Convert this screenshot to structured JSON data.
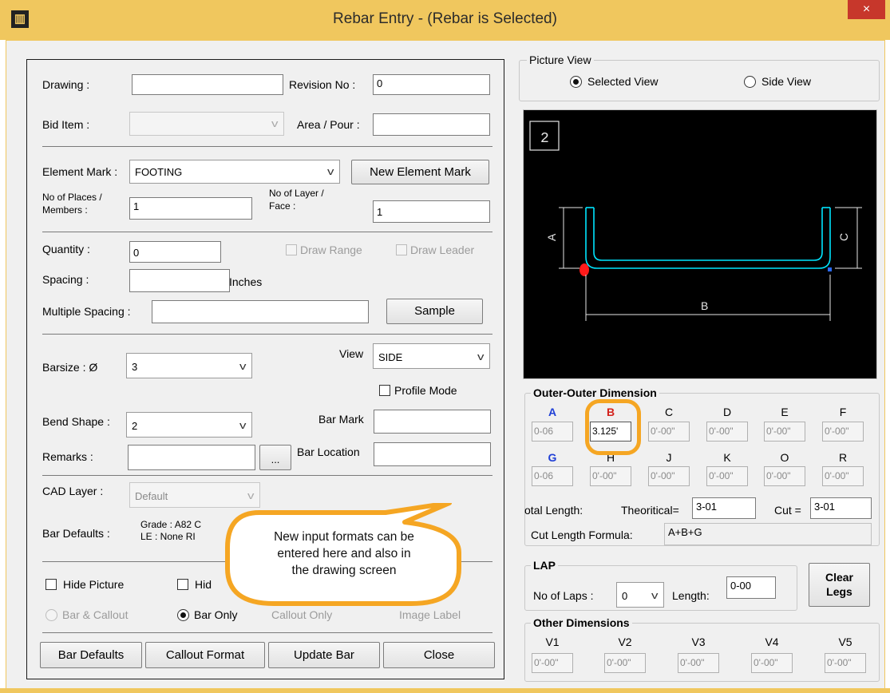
{
  "window": {
    "title": "Rebar Entry - (Rebar is Selected)",
    "close_icon": "×"
  },
  "fields": {
    "drawing_label": "Drawing :",
    "drawing_value": "",
    "revision_label": "Revision No :",
    "revision_value": "0",
    "bid_item_label": "Bid Item :",
    "bid_item_value": "",
    "area_pour_label": "Area / Pour :",
    "area_pour_value": "",
    "element_mark_label": "Element Mark :",
    "element_mark_value": "FOOTING",
    "new_element_mark_button": "New Element Mark",
    "places_label_1": "No of Places /",
    "places_label_2": "Members   :",
    "places_value": "1",
    "layer_label_1": "No of Layer /",
    "layer_label_2": "Face :",
    "layer_value": "1",
    "quantity_label": "Quantity :",
    "quantity_value": "0",
    "draw_range_label": "Draw Range",
    "draw_leader_label": "Draw Leader",
    "spacing_label": "Spacing :",
    "spacing_value": "",
    "spacing_unit": "Inches",
    "multiple_spacing_label": "Multiple Spacing :",
    "multiple_spacing_value": "",
    "sample_button": "Sample",
    "barsize_label": "Barsize  : Ø",
    "barsize_value": "3",
    "view_label": "View",
    "view_value": "SIDE",
    "profile_mode_label": "Profile Mode",
    "bend_shape_label": "Bend Shape :",
    "bend_shape_value": "2",
    "bar_mark_label": "Bar Mark",
    "bar_mark_value": "",
    "remarks_label": "Remarks :",
    "remarks_value": "",
    "ellipsis_button": "...",
    "bar_location_label": "Bar Location",
    "bar_location_value": "",
    "cad_layer_label": "CAD Layer :",
    "cad_layer_value": "Default",
    "bar_defaults_label": "Bar Defaults :",
    "bar_defaults_line1": "Grade : A82 C",
    "bar_defaults_line2": "LE : None RI",
    "hide_picture_label": "Hide Picture",
    "hide_other_label": "Hid",
    "bar_callout_label": "Bar & Callout",
    "bar_only_label": "Bar Only",
    "callout_only_label": "Callout Only",
    "image_label_label": "Image Label"
  },
  "buttons": {
    "bar_defaults": "Bar Defaults",
    "callout_format": "Callout Format",
    "update_bar": "Update Bar",
    "close": "Close"
  },
  "picture": {
    "group_label": "Picture View",
    "selected_view_label": "Selected View",
    "side_view_label": "Side View",
    "shape_number": "2",
    "dim_a": "A",
    "dim_b": "B",
    "dim_c": "C",
    "colors": {
      "bar": "#00e5ff",
      "start_marker": "#ff1a1a",
      "end_marker": "#2a6bff",
      "dim_lines": "#e6e6e6"
    }
  },
  "outer_dimension": {
    "group_label": "Outer-Outer Dimension",
    "headers_row1": [
      "A",
      "B",
      "C",
      "D",
      "E",
      "F"
    ],
    "values_row1": [
      "0-06",
      "3.125'",
      "0'-00\"",
      "0'-00\"",
      "0'-00\"",
      "0'-00\""
    ],
    "headers_row2": [
      "G",
      "H",
      "J",
      "K",
      "O",
      "R"
    ],
    "values_row2": [
      "0-06",
      "0'-00\"",
      "0'-00\"",
      "0'-00\"",
      "0'-00\"",
      "0'-00\""
    ],
    "total_length_label": "otal Length:",
    "theoretical_label": "Theoritical=",
    "theoretical_value": "3-01",
    "cut_label": "Cut =",
    "cut_value": "3-01",
    "formula_label": "Cut Length Formula:",
    "formula_value": "A+B+G"
  },
  "lap": {
    "group_label": "LAP",
    "laps_label": "No of Laps :",
    "laps_value": "0",
    "length_label": "Length:",
    "length_value": "0-00",
    "clear_legs_line1": "Clear",
    "clear_legs_line2": "Legs"
  },
  "other_dimensions": {
    "group_label": "Other Dimensions",
    "headers": [
      "V1",
      "V2",
      "V3",
      "V4",
      "V5"
    ],
    "values": [
      "0'-00\"",
      "0'-00\"",
      "0'-00\"",
      "0'-00\"",
      "0'-00\""
    ]
  },
  "callout": {
    "line1": "New input formats can be",
    "line2": "entered here and also in",
    "line3": "the drawing screen",
    "fill": "#ffffff",
    "border": "#f5a623"
  }
}
